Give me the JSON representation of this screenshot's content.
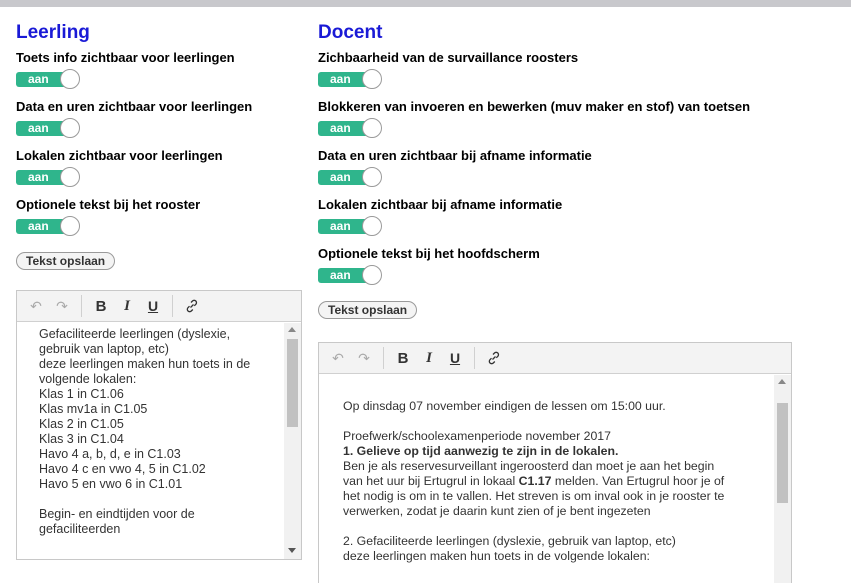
{
  "leerling": {
    "heading": "Leerling",
    "settings": [
      {
        "label": "Toets info zichtbaar voor leerlingen",
        "toggle": "aan"
      },
      {
        "label": "Data en uren zichtbaar voor leerlingen",
        "toggle": "aan"
      },
      {
        "label": "Lokalen zichtbaar voor leerlingen",
        "toggle": "aan"
      },
      {
        "label": "Optionele tekst bij het rooster",
        "toggle": "aan"
      }
    ],
    "save_label": "Tekst opslaan",
    "editor_lines": [
      "Gefaciliteerde leerlingen (dyslexie,",
      "gebruik van laptop, etc)",
      "deze leerlingen maken hun toets in de",
      "volgende lokalen:",
      "Klas 1 in C1.06",
      "Klas mv1a in C1.05",
      "Klas 2 in C1.05",
      "Klas 3 in C1.04",
      "Havo 4 a, b, d, e in C1.03",
      "Havo 4 c en vwo 4, 5 in C1.02",
      "Havo 5 en vwo 6 in C1.01",
      "",
      "Begin- en eindtijden voor de",
      "gefaciliteerden"
    ]
  },
  "docent": {
    "heading": "Docent",
    "settings": [
      {
        "label": "Zichbaarheid van de survaillance roosters",
        "toggle": "aan"
      },
      {
        "label": "Blokkeren van invoeren en bewerken (muv maker en stof) van toetsen",
        "toggle": "aan"
      },
      {
        "label": "Data en uren zichtbaar bij afname informatie",
        "toggle": "aan"
      },
      {
        "label": "Lokalen zichtbaar bij afname informatie",
        "toggle": "aan"
      },
      {
        "label": "Optionele tekst bij het hoofdscherm",
        "toggle": "aan"
      }
    ],
    "save_label": "Tekst opslaan",
    "editor": {
      "line1": "Op dinsdag 07 november eindigen de lessen om 15:00 uur.",
      "line2": "Proefwerk/schoolexamenperiode november 2017",
      "line3": "1. Gelieve op tijd aanwezig te zijn in de lokalen.",
      "line4": "Ben je als reservesurveillant ingeroosterd dan moet je aan het begin",
      "line5a": "van het uur bij Ertugrul in lokaal ",
      "line5b": "C1.17",
      "line5c": " melden. Van Ertugrul hoor je of",
      "line6": "het nodig is om in te vallen. Het streven is om inval ook in je rooster te",
      "line7": "verwerken, zodat je daarin kunt zien of je bent ingezeten",
      "line8": "2. Gefaciliteerde leerlingen (dyslexie, gebruik van laptop, etc)",
      "line9": "deze leerlingen maken hun toets in de volgende lokalen:"
    }
  },
  "toolbar_icons": [
    "undo-icon",
    "redo-icon",
    "bold-icon",
    "italic-icon",
    "underline-icon",
    "link-icon"
  ],
  "toolbar_glyphs": {
    "bold": "B",
    "italic": "I",
    "underline": "U"
  },
  "colors": {
    "heading": "#1a1ad6",
    "toggle_on": "#2fb58c"
  }
}
